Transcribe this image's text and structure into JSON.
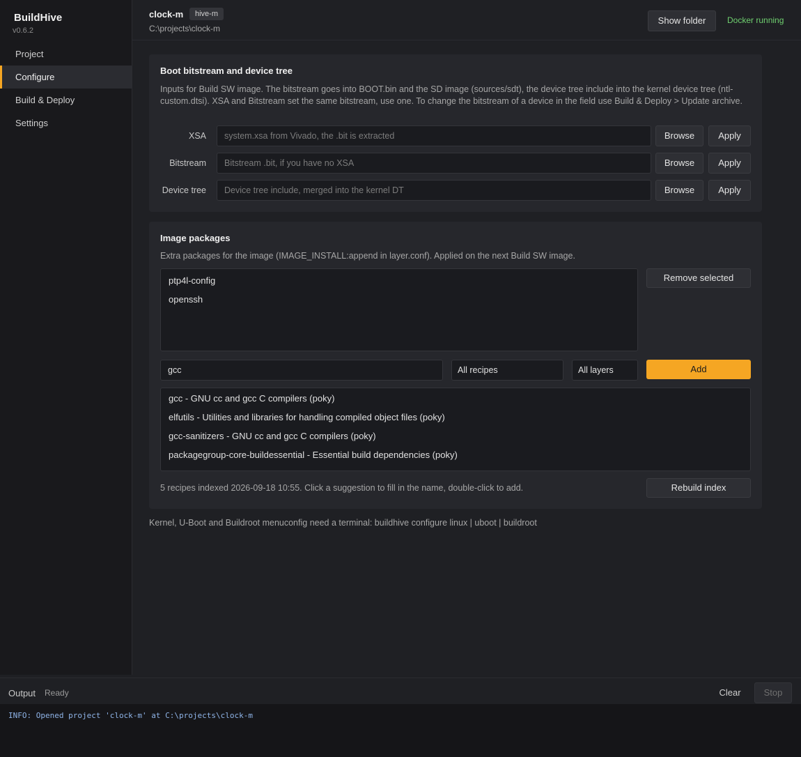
{
  "app": {
    "title": "BuildHive",
    "version": "v0.6.2"
  },
  "nav": [
    {
      "label": "Project"
    },
    {
      "label": "Configure",
      "active": true
    },
    {
      "label": "Build & Deploy"
    },
    {
      "label": "Settings"
    }
  ],
  "header": {
    "project_name": "clock-m",
    "badge": "hive-m",
    "path": "C:\\projects\\clock-m",
    "show_folder_label": "Show folder",
    "docker_status": "Docker running"
  },
  "boot": {
    "title": "Boot bitstream and device tree",
    "description": "Inputs for Build SW image. The bitstream goes into BOOT.bin and the SD image (sources/sdt), the device tree include into the kernel device tree (ntl-custom.dtsi). XSA and Bitstream set the same bitstream, use one. To change the bitstream of a device in the field use Build & Deploy > Update archive.",
    "fields": [
      {
        "label": "XSA",
        "placeholder": "system.xsa from Vivado, the .bit is extracted",
        "value": ""
      },
      {
        "label": "Bitstream",
        "placeholder": "Bitstream .bit, if you have no XSA",
        "value": ""
      },
      {
        "label": "Device tree",
        "placeholder": "Device tree include, merged into the kernel DT",
        "value": ""
      }
    ],
    "browse_label": "Browse",
    "apply_label": "Apply"
  },
  "packages": {
    "title": "Image packages",
    "description": "Extra packages for the image (IMAGE_INSTALL:append in layer.conf). Applied on the next Build SW image.",
    "installed": [
      "ptp4l-config",
      "openssh"
    ],
    "remove_label": "Remove selected",
    "search_value": "gcc",
    "recipes_filter": "All recipes",
    "layers_filter": "All layers",
    "add_label": "Add",
    "suggestions": [
      "gcc  -  GNU cc and gcc C compilers  (poky)",
      "elfutils  -  Utilities and libraries for handling compiled object files  (poky)",
      "gcc-sanitizers  -  GNU cc and gcc C compilers  (poky)",
      "packagegroup-core-buildessential  -  Essential build dependencies  (poky)"
    ],
    "footer": "5 recipes indexed 2026-09-18 10:55. Click a suggestion to fill in the name, double-click to add.",
    "rebuild_label": "Rebuild index"
  },
  "hint": "Kernel, U-Boot and Buildroot menuconfig need a terminal: buildhive configure linux | uboot | buildroot",
  "output": {
    "label": "Output",
    "status": "Ready",
    "clear_label": "Clear",
    "stop_label": "Stop",
    "log": "INFO: Opened project 'clock-m' at C:\\projects\\clock-m"
  },
  "colors": {
    "accent": "#f5a623",
    "docker_ok": "#6fcf6f",
    "log_info": "#8fb4e8"
  }
}
